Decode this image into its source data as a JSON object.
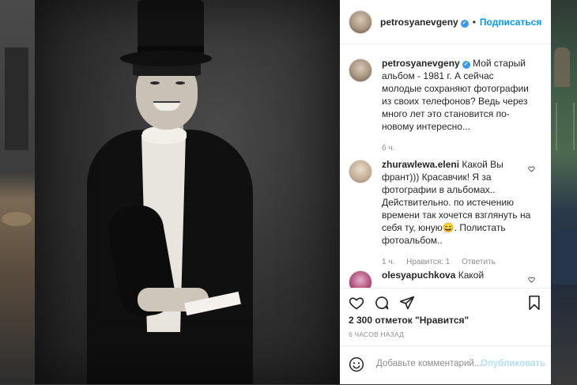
{
  "post": {
    "username": "petrosyanevgeny",
    "follow_label": "Подписаться",
    "separator": "•",
    "caption": "Мой старый альбом - 1981 г. А сейчас молодые сохраняют фотографии из своих телефонов? Ведь через много лет это становится по-новому интересно...",
    "caption_time": "6 ч.",
    "likes": "2 300 отметок \"Нравится\"",
    "time_ago": "6 ЧАСОВ НАЗАД"
  },
  "comments": [
    {
      "username": "zhurawlewa.eleni",
      "text": "Какой Вы франт))) Красавчик! Я за фотографии в альбомах.. Действительно. по истечению времени так хочется взглянуть на себя ту, юную😄. Полистать фотоальбом..",
      "time": "1 ч.",
      "likes": "Нравится: 1",
      "reply": "Ответить"
    },
    {
      "username": "olesyapuchkova",
      "text": "Какой"
    }
  ],
  "add_comment": {
    "placeholder": "Добавьте комментарий...",
    "publish_label": "Опубликовать"
  },
  "icons": {
    "verified": "verified-badge-icon",
    "like": "heart-icon",
    "comment": "comment-icon",
    "share": "send-icon",
    "save": "bookmark-icon",
    "emoji": "emoji-icon"
  },
  "colors": {
    "accent": "#0095f6",
    "verified": "#3897f0",
    "muted": "#8e8e8e",
    "publish_disabled": "#b2dffc"
  }
}
